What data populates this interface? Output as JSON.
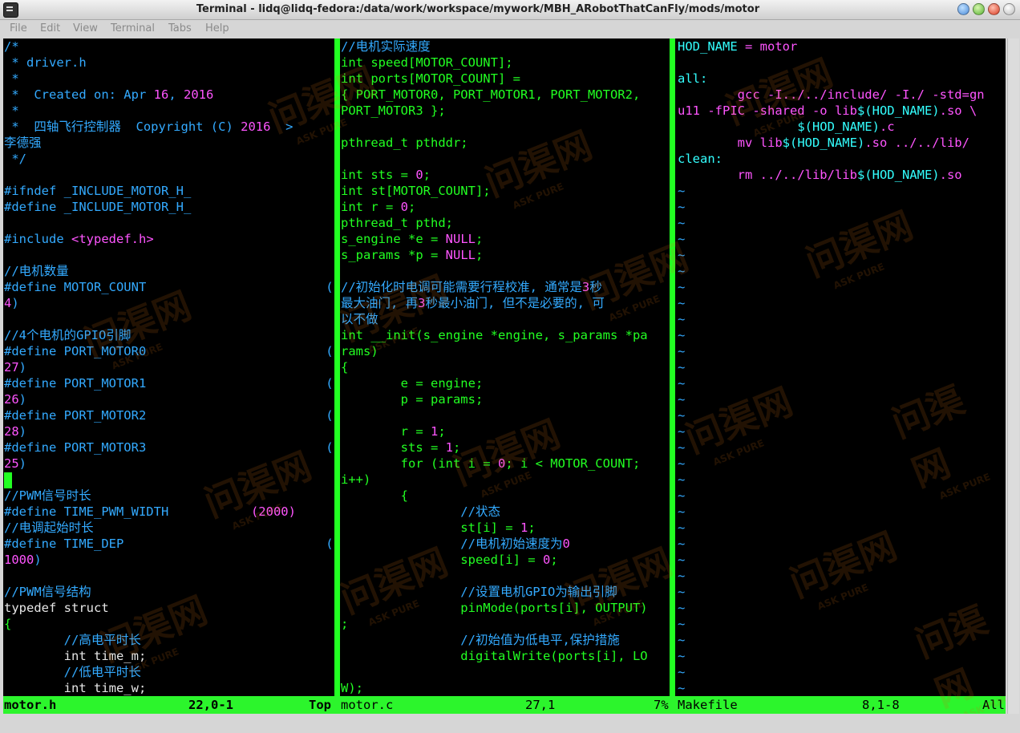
{
  "window": {
    "title": "Terminal - lidq@lidq-fedora:/data/work/workspace/mywork/MBH_ARobotThatCanFly/mods/motor",
    "icons": [
      "terminal-icon",
      "minimize-icon",
      "maximize-icon",
      "close-icon",
      "restore-icon"
    ]
  },
  "menu": [
    "File",
    "Edit",
    "View",
    "Terminal",
    "Tabs",
    "Help"
  ],
  "colors": {
    "background": "#000000",
    "comment": "#33aaff",
    "preproc": "#ff55ff",
    "number": "#ff55ff",
    "string": "#ff55ff",
    "keyword": "#22ff22",
    "type": "#22ff22",
    "plain": "#e6e6e6",
    "identifier": "#33ffff",
    "statusline": "#2cf52c"
  },
  "panes": {
    "left": [
      [
        [
          "/*",
          "comment"
        ]
      ],
      [
        [
          " * driver.h",
          "comment"
        ]
      ],
      [
        [
          " *",
          "comment"
        ]
      ],
      [
        [
          " *  Created on: Apr ",
          "comment"
        ],
        [
          "16",
          "number"
        ],
        [
          ", ",
          "comment"
        ],
        [
          "2016",
          "number"
        ]
      ],
      [
        [
          " *",
          "comment"
        ]
      ],
      [
        [
          " *  四轴飞行控制器  Copyright (C) ",
          "comment"
        ],
        [
          "2016",
          "number"
        ],
        [
          "  >",
          "comment"
        ]
      ],
      [
        [
          "李德强",
          "comment"
        ]
      ],
      [
        [
          " */",
          "comment"
        ]
      ],
      [
        [
          "",
          "plain"
        ]
      ],
      [
        [
          "#ifndef _INCLUDE_MOTOR_H_",
          "comment"
        ]
      ],
      [
        [
          "#define _INCLUDE_MOTOR_H_",
          "comment"
        ]
      ],
      [
        [
          "",
          "plain"
        ]
      ],
      [
        [
          "#include ",
          "comment"
        ],
        [
          "<typedef.h>",
          "string"
        ]
      ],
      [
        [
          "",
          "plain"
        ]
      ],
      [
        [
          "//电机数量",
          "comment"
        ]
      ],
      [
        [
          "#define MOTOR_COUNT                        (",
          "comment"
        ]
      ],
      [
        [
          "4",
          "number"
        ],
        [
          ")",
          "comment"
        ]
      ],
      [
        [
          "",
          "plain"
        ]
      ],
      [
        [
          "//4个电机的GPIO引脚",
          "comment"
        ]
      ],
      [
        [
          "#define PORT_MOTOR0                        (",
          "comment"
        ]
      ],
      [
        [
          "27",
          "number"
        ],
        [
          ")",
          "comment"
        ]
      ],
      [
        [
          "#define PORT_MOTOR1                        (",
          "comment"
        ]
      ],
      [
        [
          "26",
          "number"
        ],
        [
          ")",
          "comment"
        ]
      ],
      [
        [
          "#define PORT_MOTOR2                        (",
          "comment"
        ]
      ],
      [
        [
          "28",
          "number"
        ],
        [
          ")",
          "comment"
        ]
      ],
      [
        [
          "#define PORT_MOTOR3                        (",
          "comment"
        ]
      ],
      [
        [
          "25",
          "number"
        ],
        [
          ")",
          "comment"
        ]
      ],
      [
        [
          "",
          "plain"
        ]
      ],
      [
        [
          "//PWM信号时长",
          "comment"
        ]
      ],
      [
        [
          "#define TIME_PWM_WIDTH           ",
          "comment"
        ],
        [
          "(2000)",
          "number"
        ]
      ],
      [
        [
          "//电调起始时长",
          "comment"
        ]
      ],
      [
        [
          "#define TIME_DEP                           (",
          "comment"
        ]
      ],
      [
        [
          "1000",
          "number"
        ],
        [
          ")",
          "comment"
        ]
      ],
      [
        [
          "",
          "plain"
        ]
      ],
      [
        [
          "//PWM信号结构",
          "comment"
        ]
      ],
      [
        [
          "typedef struct",
          "plain"
        ]
      ],
      [
        [
          "{",
          "keyword"
        ]
      ],
      [
        [
          "        //高电平时长",
          "comment"
        ]
      ],
      [
        [
          "        int time_m;",
          "plain"
        ]
      ],
      [
        [
          "        //低电平时长",
          "comment"
        ]
      ],
      [
        [
          "        int time_w;",
          "plain"
        ]
      ]
    ],
    "middle": [
      [
        [
          "//电机实际速度",
          "comment"
        ]
      ],
      [
        [
          "int speed[MOTOR_COUNT];",
          "keyword"
        ]
      ],
      [
        [
          "int ports[MOTOR_COUNT] =",
          "keyword"
        ]
      ],
      [
        [
          "{ PORT_MOTOR0, PORT_MOTOR1, PORT_MOTOR2,",
          "keyword"
        ]
      ],
      [
        [
          "PORT_MOTOR3 };",
          "keyword"
        ]
      ],
      [
        [
          "",
          "plain"
        ]
      ],
      [
        [
          "pthread_t pthddr;",
          "keyword"
        ]
      ],
      [
        [
          "",
          "plain"
        ]
      ],
      [
        [
          "int sts = ",
          "keyword"
        ],
        [
          "0",
          "number"
        ],
        [
          ";",
          "keyword"
        ]
      ],
      [
        [
          "int st[MOTOR_COUNT];",
          "keyword"
        ]
      ],
      [
        [
          "int r = ",
          "keyword"
        ],
        [
          "0",
          "number"
        ],
        [
          ";",
          "keyword"
        ]
      ],
      [
        [
          "pthread_t pthd;",
          "keyword"
        ]
      ],
      [
        [
          "s_engine *e = ",
          "keyword"
        ],
        [
          "NULL",
          "number"
        ],
        [
          ";",
          "keyword"
        ]
      ],
      [
        [
          "s_params *p = ",
          "keyword"
        ],
        [
          "NULL",
          "number"
        ],
        [
          ";",
          "keyword"
        ]
      ],
      [
        [
          "",
          "plain"
        ]
      ],
      [
        [
          "//初始化时电调可能需要行程校准, 通常是",
          "comment"
        ],
        [
          "3",
          "number"
        ],
        [
          "秒",
          "comment"
        ]
      ],
      [
        [
          "最大油门, 再",
          "comment"
        ],
        [
          "3",
          "number"
        ],
        [
          "秒最小油门, 但不是必要的, 可",
          "comment"
        ]
      ],
      [
        [
          "以不做",
          "comment"
        ]
      ],
      [
        [
          "int __init(s_engine *engine, s_params *pa",
          "keyword"
        ]
      ],
      [
        [
          "rams)",
          "keyword"
        ]
      ],
      [
        [
          "{",
          "keyword"
        ]
      ],
      [
        [
          "        e = engine;",
          "keyword"
        ]
      ],
      [
        [
          "        p = params;",
          "keyword"
        ]
      ],
      [
        [
          "",
          "plain"
        ]
      ],
      [
        [
          "        r = ",
          "keyword"
        ],
        [
          "1",
          "number"
        ],
        [
          ";",
          "keyword"
        ]
      ],
      [
        [
          "        sts = ",
          "keyword"
        ],
        [
          "1",
          "number"
        ],
        [
          ";",
          "keyword"
        ]
      ],
      [
        [
          "        for (int i = ",
          "keyword"
        ],
        [
          "0",
          "number"
        ],
        [
          "; i < MOTOR_COUNT;",
          "keyword"
        ]
      ],
      [
        [
          "i++)",
          "keyword"
        ]
      ],
      [
        [
          "        {",
          "keyword"
        ]
      ],
      [
        [
          "                //状态",
          "comment"
        ]
      ],
      [
        [
          "                st[i] = ",
          "keyword"
        ],
        [
          "1",
          "number"
        ],
        [
          ";",
          "keyword"
        ]
      ],
      [
        [
          "                //电机初始速度为",
          "comment"
        ],
        [
          "0",
          "number"
        ]
      ],
      [
        [
          "                speed[i] = ",
          "keyword"
        ],
        [
          "0",
          "number"
        ],
        [
          ";",
          "keyword"
        ]
      ],
      [
        [
          "",
          "plain"
        ]
      ],
      [
        [
          "                //设置电机GPIO为输出引脚",
          "comment"
        ]
      ],
      [
        [
          "                pinMode(ports[i], OUTPUT)",
          "keyword"
        ]
      ],
      [
        [
          ";",
          "keyword"
        ]
      ],
      [
        [
          "                //初始值为低电平,保护措施",
          "comment"
        ]
      ],
      [
        [
          "                digitalWrite(ports[i], LO",
          "keyword"
        ]
      ],
      [
        [
          "",
          "plain"
        ]
      ],
      [
        [
          "W);",
          "keyword"
        ]
      ]
    ],
    "right": [
      [
        [
          "HOD_NAME",
          "identifier"
        ],
        [
          " = motor",
          "preproc"
        ]
      ],
      [
        [
          "",
          "plain"
        ]
      ],
      [
        [
          "all:",
          "identifier"
        ]
      ],
      [
        [
          "        gcc -I../../include/ -I./ -std=gn",
          "preproc"
        ]
      ],
      [
        [
          "u11 -fPIC -shared -o lib",
          "preproc"
        ],
        [
          "$(HOD_NAME)",
          "identifier"
        ],
        [
          ".so \\",
          "preproc"
        ]
      ],
      [
        [
          "                ",
          "plain"
        ],
        [
          "$(HOD_NAME)",
          "identifier"
        ],
        [
          ".c",
          "preproc"
        ]
      ],
      [
        [
          "        mv lib",
          "preproc"
        ],
        [
          "$(HOD_NAME)",
          "identifier"
        ],
        [
          ".so ../../lib/",
          "preproc"
        ]
      ],
      [
        [
          "clean:",
          "identifier"
        ]
      ],
      [
        [
          "        rm ../../lib/lib",
          "preproc"
        ],
        [
          "$(HOD_NAME)",
          "identifier"
        ],
        [
          ".so",
          "preproc"
        ]
      ],
      [
        [
          "~",
          "comment"
        ]
      ],
      [
        [
          "~",
          "comment"
        ]
      ],
      [
        [
          "~",
          "comment"
        ]
      ],
      [
        [
          "~",
          "comment"
        ]
      ],
      [
        [
          "~",
          "comment"
        ]
      ],
      [
        [
          "~",
          "comment"
        ]
      ],
      [
        [
          "~",
          "comment"
        ]
      ],
      [
        [
          "~",
          "comment"
        ]
      ],
      [
        [
          "~",
          "comment"
        ]
      ],
      [
        [
          "~",
          "comment"
        ]
      ],
      [
        [
          "~",
          "comment"
        ]
      ],
      [
        [
          "~",
          "comment"
        ]
      ],
      [
        [
          "~",
          "comment"
        ]
      ],
      [
        [
          "~",
          "comment"
        ]
      ],
      [
        [
          "~",
          "comment"
        ]
      ],
      [
        [
          "~",
          "comment"
        ]
      ],
      [
        [
          "~",
          "comment"
        ]
      ],
      [
        [
          "~",
          "comment"
        ]
      ],
      [
        [
          "~",
          "comment"
        ]
      ],
      [
        [
          "~",
          "comment"
        ]
      ],
      [
        [
          "~",
          "comment"
        ]
      ],
      [
        [
          "~",
          "comment"
        ]
      ],
      [
        [
          "~",
          "comment"
        ]
      ],
      [
        [
          "~",
          "comment"
        ]
      ],
      [
        [
          "~",
          "comment"
        ]
      ],
      [
        [
          "~",
          "comment"
        ]
      ],
      [
        [
          "~",
          "comment"
        ]
      ],
      [
        [
          "~",
          "comment"
        ]
      ],
      [
        [
          "~",
          "comment"
        ]
      ],
      [
        [
          "~",
          "comment"
        ]
      ],
      [
        [
          "~",
          "comment"
        ]
      ],
      [
        [
          "~",
          "comment"
        ]
      ]
    ]
  },
  "status": {
    "left": {
      "file": "motor.h",
      "pos": "22,0-1",
      "scroll": "Top"
    },
    "middle": {
      "file": "motor.c",
      "pos": "27,1",
      "scroll": "7%"
    },
    "right": {
      "file": "Makefile",
      "pos": "8,1-8",
      "scroll": "All"
    }
  },
  "watermark": {
    "text": "问渠网",
    "sub": "ASK PURE"
  }
}
